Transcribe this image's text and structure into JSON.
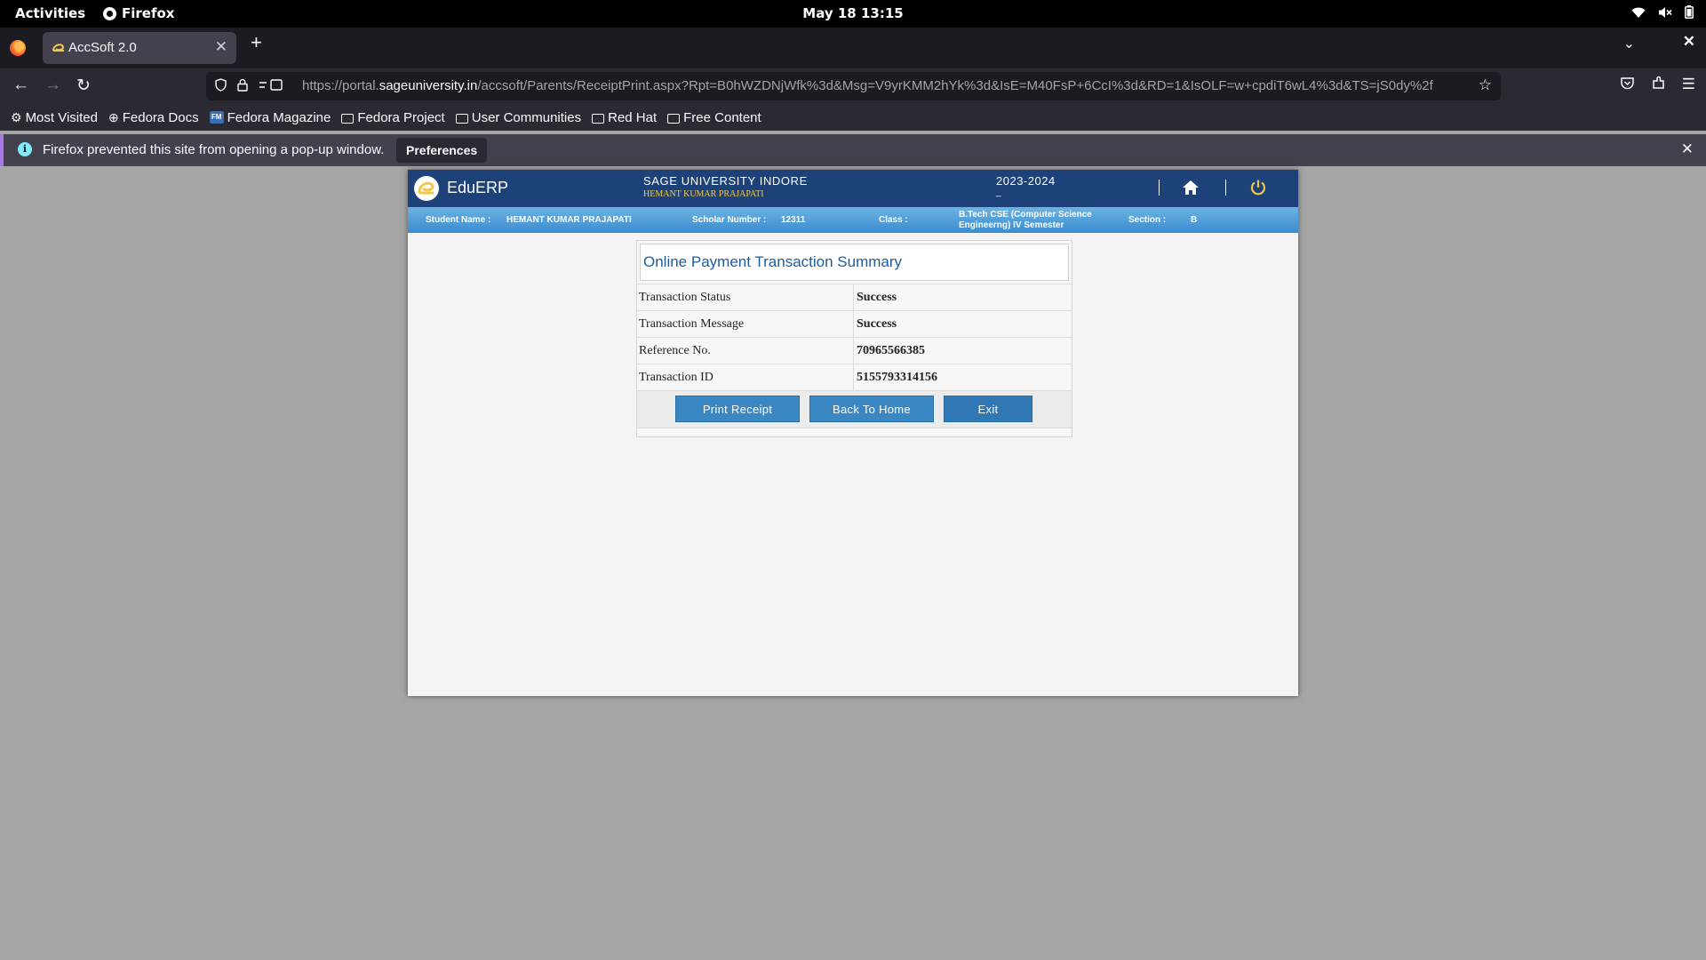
{
  "system_bar": {
    "activities": "Activities",
    "app_name": "Firefox",
    "clock": "May 18  13:15"
  },
  "browser": {
    "tab_title": "AccSoft 2.0",
    "url_host_prefix": "https://portal.",
    "url_host": "sageuniversity.in",
    "url_path": "/accsoft/Parents/ReceiptPrint.aspx?Rpt=B0hWZDNjWfk%3d&Msg=V9yrKMM2hYk%3d&IsE=M40FsP+6CcI%3d&RD=1&IsOLF=w+cpdiT6wL4%3d&TS=jS0dy%2f",
    "bookmarks": [
      {
        "label": "Most Visited",
        "icon": "gear-icon"
      },
      {
        "label": "Fedora Docs",
        "icon": "globe-icon"
      },
      {
        "label": "Fedora Magazine",
        "icon": "fedora-magazine-icon"
      },
      {
        "label": "Fedora Project",
        "icon": "folder-icon"
      },
      {
        "label": "User Communities",
        "icon": "folder-icon"
      },
      {
        "label": "Red Hat",
        "icon": "folder-icon"
      },
      {
        "label": "Free Content",
        "icon": "folder-icon"
      }
    ],
    "popup_notice": "Firefox prevented this site from opening a pop-up window.",
    "preferences_label": "Preferences"
  },
  "erp": {
    "brand": "EduERP",
    "university": "SAGE UNIVERSITY INDORE",
    "user_name": "HEMANT KUMAR PRAJAPATI",
    "session": "2023-2024",
    "session_sub": "_",
    "student": {
      "name_label": "Student Name :",
      "name": "HEMANT KUMAR PRAJAPATI",
      "scholar_label": "Scholar Number :",
      "scholar_number": "12311",
      "class_label": "Class :",
      "class_line1": "B.Tech CSE (Computer Science",
      "class_line2": "Engineerng) IV Semester",
      "section_label": "Section :",
      "section": "B"
    },
    "summary": {
      "title": "Online Payment Transaction Summary",
      "rows": [
        {
          "label": "Transaction Status",
          "value": "Success"
        },
        {
          "label": "Transaction Message",
          "value": "Success"
        },
        {
          "label": "Reference No.",
          "value": "70965566385"
        },
        {
          "label": "Transaction ID",
          "value": "5155793314156"
        }
      ],
      "buttons": {
        "print": "Print Receipt",
        "home": "Back To Home",
        "exit": "Exit"
      }
    },
    "colors": {
      "header": "#1d4279",
      "button": "#3b87c2",
      "accent_yellow": "#f2c84b"
    }
  }
}
